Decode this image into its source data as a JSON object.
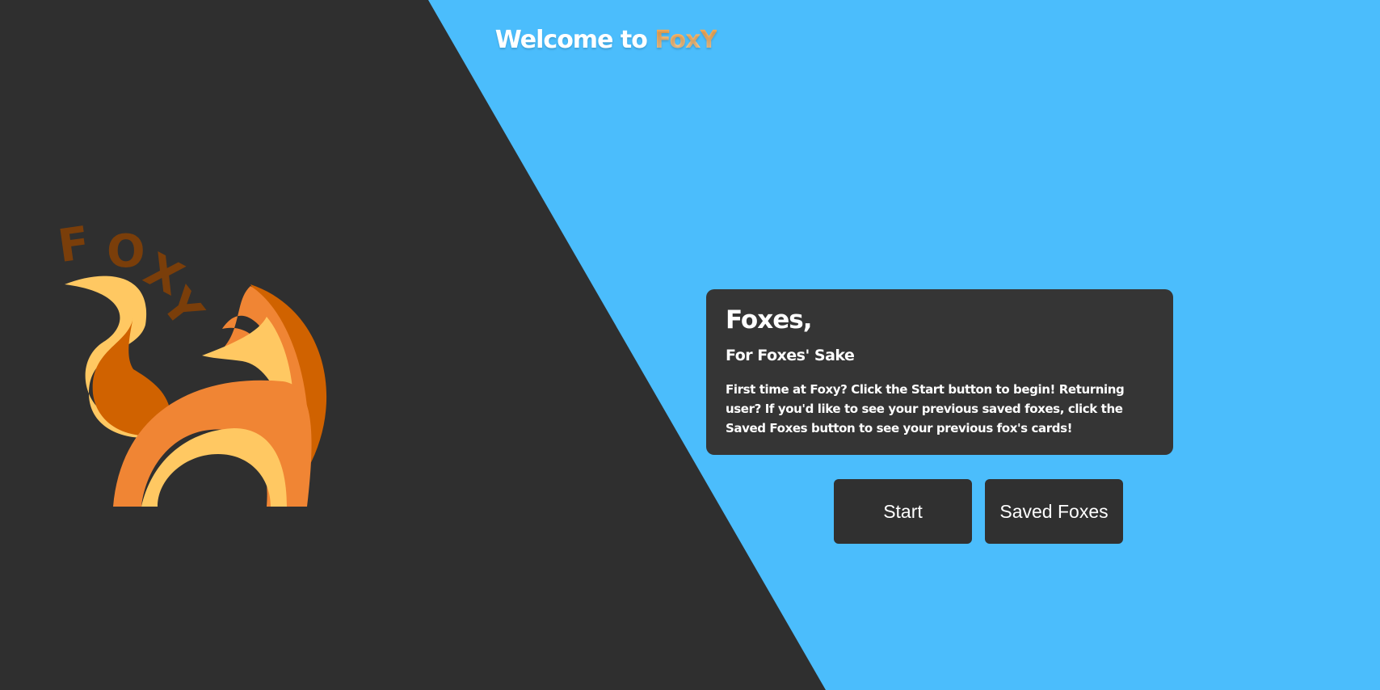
{
  "header": {
    "welcome_prefix": "Welcome to ",
    "brand_name": "FoxY"
  },
  "logo": {
    "text_letters": [
      "F",
      "O",
      "X",
      "Y"
    ],
    "colors": {
      "text": "#7a3e0a",
      "light_yellow": "#ffc862",
      "mid_orange": "#f08534",
      "dark_orange": "#d06200"
    }
  },
  "card": {
    "title": "Foxes,",
    "subtitle": "For Foxes' Sake",
    "body": "First time at Foxy? Click the Start button to begin! Returning user? If you'd like to see your previous saved foxes, click the Saved Foxes button to see your previous fox's cards!"
  },
  "buttons": {
    "start_label": "Start",
    "saved_label": "Saved Foxes"
  },
  "theme": {
    "background_blue": "#4bbdfc",
    "background_dark": "#2f2f2f",
    "card_bg": "#353535",
    "button_bg": "#303030"
  }
}
